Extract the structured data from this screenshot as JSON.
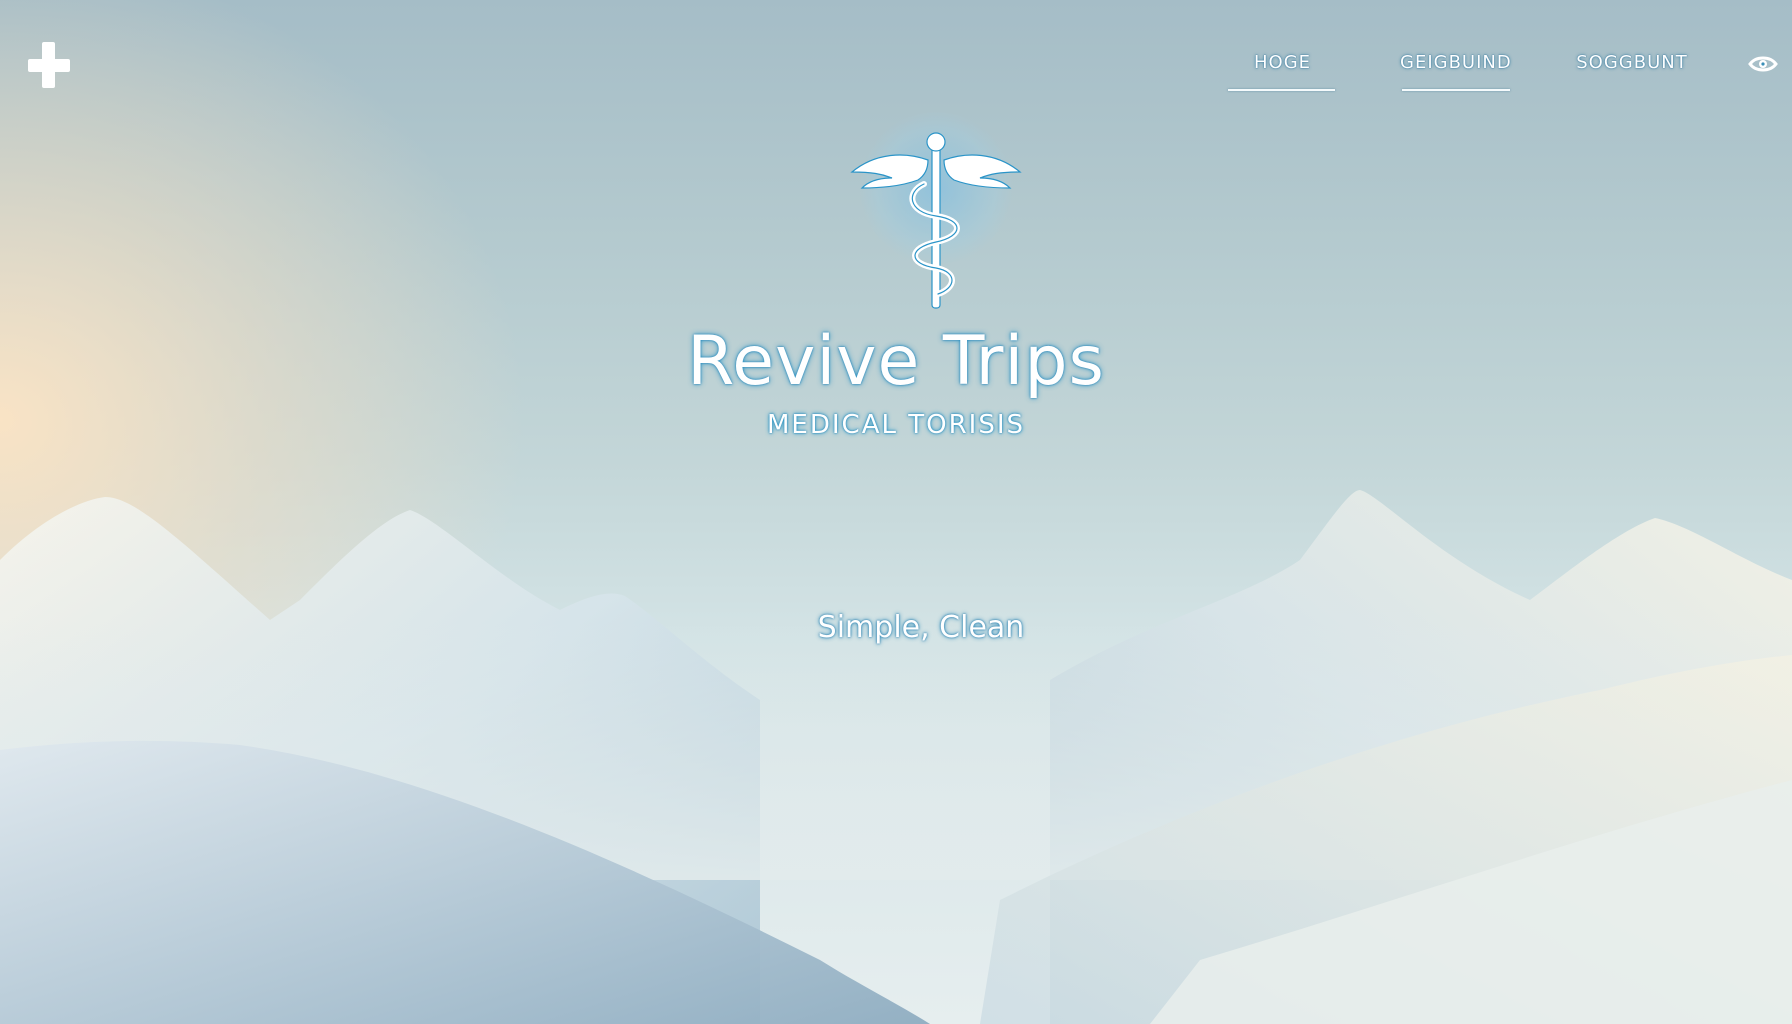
{
  "header": {
    "logo_icon": "plus-icon",
    "nav": [
      {
        "label": "HOGE",
        "active": true
      },
      {
        "label": "GEIGBUIND",
        "active": true
      },
      {
        "label": "SOGGBUNT",
        "active": false
      }
    ],
    "extra_icon": "eye-icon"
  },
  "hero": {
    "emblem_icon": "caduceus-icon",
    "title": "Revive Trips",
    "subtitle": "MEDICAL TORISIS",
    "tagline": "Simple, Clean"
  },
  "colors": {
    "text": "#ffffff",
    "glow": "#2a94c8",
    "sky_top": "#a5bdc7",
    "sky_warm": "#fce4c4"
  }
}
